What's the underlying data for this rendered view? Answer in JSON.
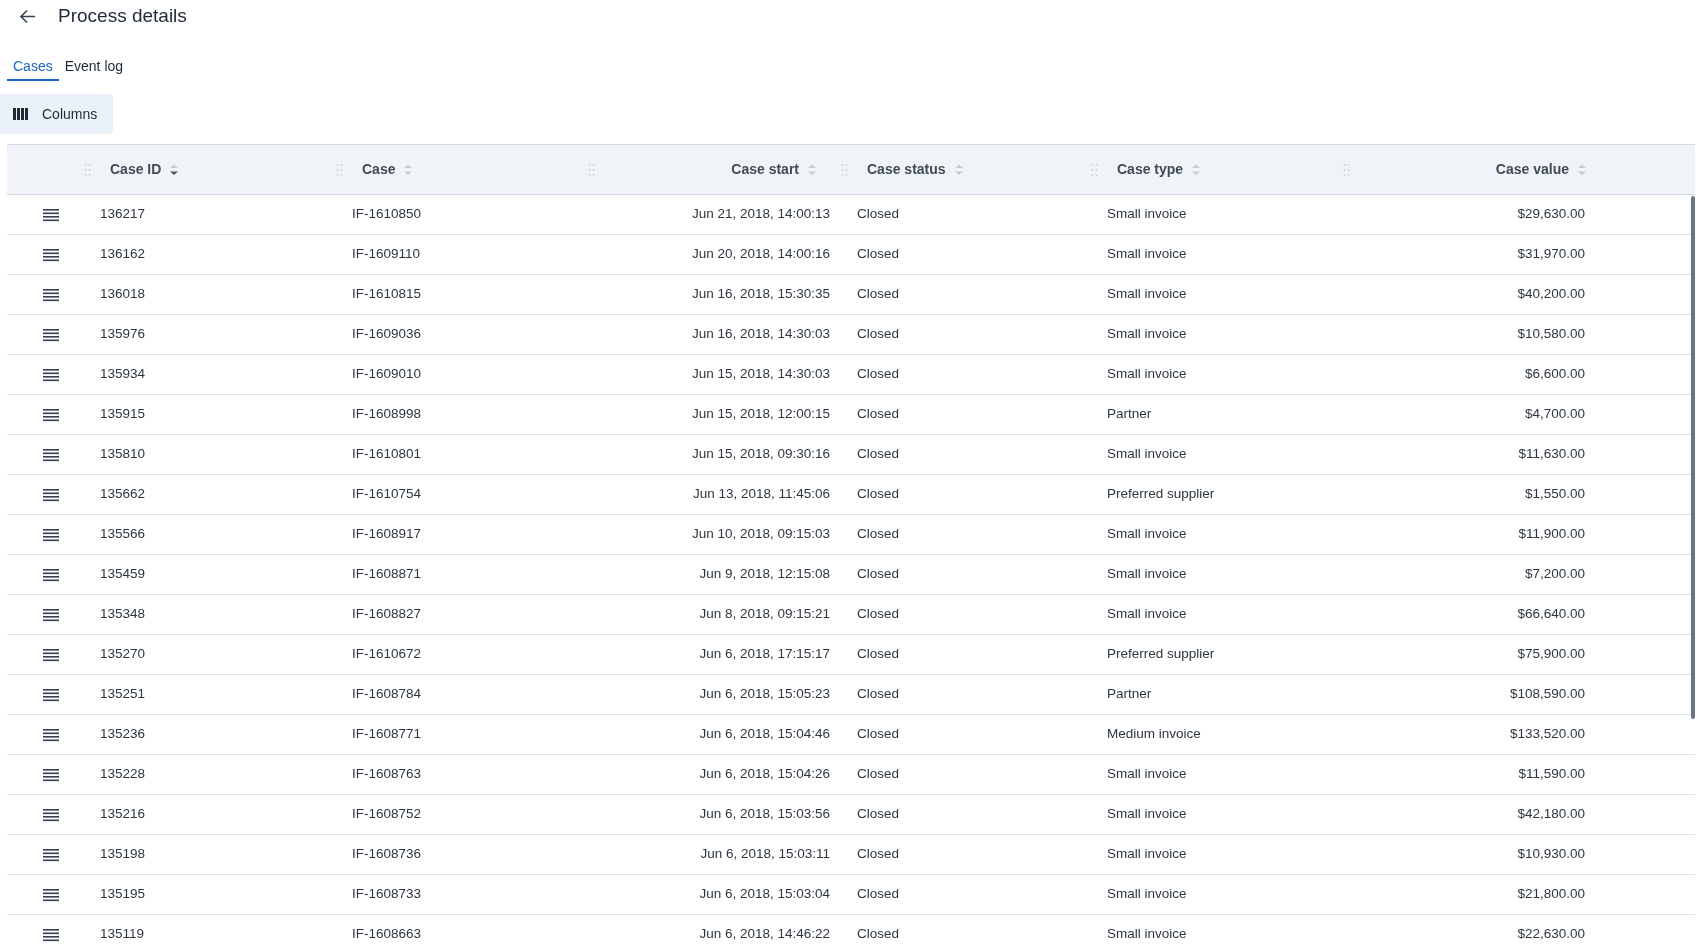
{
  "page": {
    "title": "Process details"
  },
  "tabs": [
    {
      "label": "Cases",
      "selected": true
    },
    {
      "label": "Event log",
      "selected": false
    }
  ],
  "columns_button": {
    "label": "Columns"
  },
  "table": {
    "columns": [
      {
        "label": "Case ID",
        "right_aligned": false,
        "sorted": true
      },
      {
        "label": "Case",
        "right_aligned": false,
        "sorted": false
      },
      {
        "label": "Case start",
        "right_aligned": true,
        "sorted": false
      },
      {
        "label": "Case status",
        "right_aligned": false,
        "sorted": false
      },
      {
        "label": "Case type",
        "right_aligned": false,
        "sorted": false
      },
      {
        "label": "Case value",
        "right_aligned": true,
        "sorted": false
      }
    ],
    "rows": [
      [
        "136217",
        "IF-1610850",
        "Jun 21, 2018, 14:00:13",
        "Closed",
        "Small invoice",
        "$29,630.00"
      ],
      [
        "136162",
        "IF-1609110",
        "Jun 20, 2018, 14:00:16",
        "Closed",
        "Small invoice",
        "$31,970.00"
      ],
      [
        "136018",
        "IF-1610815",
        "Jun 16, 2018, 15:30:35",
        "Closed",
        "Small invoice",
        "$40,200.00"
      ],
      [
        "135976",
        "IF-1609036",
        "Jun 16, 2018, 14:30:03",
        "Closed",
        "Small invoice",
        "$10,580.00"
      ],
      [
        "135934",
        "IF-1609010",
        "Jun 15, 2018, 14:30:03",
        "Closed",
        "Small invoice",
        "$6,600.00"
      ],
      [
        "135915",
        "IF-1608998",
        "Jun 15, 2018, 12:00:15",
        "Closed",
        "Partner",
        "$4,700.00"
      ],
      [
        "135810",
        "IF-1610801",
        "Jun 15, 2018, 09:30:16",
        "Closed",
        "Small invoice",
        "$11,630.00"
      ],
      [
        "135662",
        "IF-1610754",
        "Jun 13, 2018, 11:45:06",
        "Closed",
        "Preferred supplier",
        "$1,550.00"
      ],
      [
        "135566",
        "IF-1608917",
        "Jun 10, 2018, 09:15:03",
        "Closed",
        "Small invoice",
        "$11,900.00"
      ],
      [
        "135459",
        "IF-1608871",
        "Jun 9, 2018, 12:15:08",
        "Closed",
        "Small invoice",
        "$7,200.00"
      ],
      [
        "135348",
        "IF-1608827",
        "Jun 8, 2018, 09:15:21",
        "Closed",
        "Small invoice",
        "$66,640.00"
      ],
      [
        "135270",
        "IF-1610672",
        "Jun 6, 2018, 17:15:17",
        "Closed",
        "Preferred supplier",
        "$75,900.00"
      ],
      [
        "135251",
        "IF-1608784",
        "Jun 6, 2018, 15:05:23",
        "Closed",
        "Partner",
        "$108,590.00"
      ],
      [
        "135236",
        "IF-1608771",
        "Jun 6, 2018, 15:04:46",
        "Closed",
        "Medium invoice",
        "$133,520.00"
      ],
      [
        "135228",
        "IF-1608763",
        "Jun 6, 2018, 15:04:26",
        "Closed",
        "Small invoice",
        "$11,590.00"
      ],
      [
        "135216",
        "IF-1608752",
        "Jun 6, 2018, 15:03:56",
        "Closed",
        "Small invoice",
        "$42,180.00"
      ],
      [
        "135198",
        "IF-1608736",
        "Jun 6, 2018, 15:03:11",
        "Closed",
        "Small invoice",
        "$10,930.00"
      ],
      [
        "135195",
        "IF-1608733",
        "Jun 6, 2018, 15:03:04",
        "Closed",
        "Small invoice",
        "$21,800.00"
      ],
      [
        "135119",
        "IF-1608663",
        "Jun 6, 2018, 14:46:22",
        "Closed",
        "Small invoice",
        "$22,630.00"
      ]
    ]
  }
}
